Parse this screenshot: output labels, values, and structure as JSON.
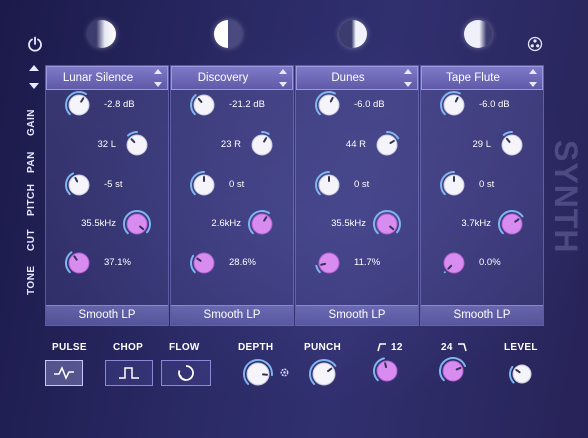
{
  "colors": {
    "accent": "#d88cf0",
    "ring": "#7fb6f0",
    "panel": "#6e6ab8"
  },
  "header": {
    "power_icon": "power-icon",
    "settings_icon": "nuclear-icon"
  },
  "row_labels": [
    "GAIN",
    "PAN",
    "PITCH",
    "CUT",
    "TONE"
  ],
  "strips": [
    {
      "name": "Lunar Silence",
      "gain": "-2.8 dB",
      "pan": "32 L",
      "pitch": "-5 st",
      "cut": "35.5kHz",
      "tone": "37.1%",
      "filter": "Smooth LP",
      "levels": {
        "gain": 0.62,
        "pan": -0.32,
        "pitch": 0.4,
        "cut": 0.98,
        "tone": 0.37
      }
    },
    {
      "name": "Discovery",
      "gain": "-21.2 dB",
      "pan": "23 R",
      "pitch": "0 st",
      "cut": "2.6kHz",
      "tone": "28.6%",
      "filter": "Smooth LP",
      "levels": {
        "gain": 0.35,
        "pan": 0.23,
        "pitch": 0.5,
        "cut": 0.62,
        "tone": 0.29
      }
    },
    {
      "name": "Dunes",
      "gain": "-6.0 dB",
      "pan": "44 R",
      "pitch": "0 st",
      "cut": "35.5kHz",
      "tone": "11.7%",
      "filter": "Smooth LP",
      "levels": {
        "gain": 0.6,
        "pan": 0.44,
        "pitch": 0.5,
        "cut": 0.98,
        "tone": 0.12
      }
    },
    {
      "name": "Tape Flute",
      "gain": "-6.0 dB",
      "pan": "29 L",
      "pitch": "0 st",
      "cut": "3.7kHz",
      "tone": "0.0%",
      "filter": "Smooth LP",
      "levels": {
        "gain": 0.6,
        "pan": -0.29,
        "pitch": 0.5,
        "cut": 0.7,
        "tone": 0.0
      }
    }
  ],
  "side_label": "SYNTH",
  "bottom": {
    "pulse": "PULSE",
    "chop": "CHOP",
    "flow": "FLOW",
    "depth": "DEPTH",
    "punch": "PUNCH",
    "hp12": "12",
    "lp24": "24",
    "level": "LEVEL",
    "active_mode": "pulse",
    "knob_levels": {
      "depth": 0.85,
      "punch": 0.7,
      "hp12": 0.45,
      "lp24": 0.75,
      "level": 0.3
    }
  }
}
